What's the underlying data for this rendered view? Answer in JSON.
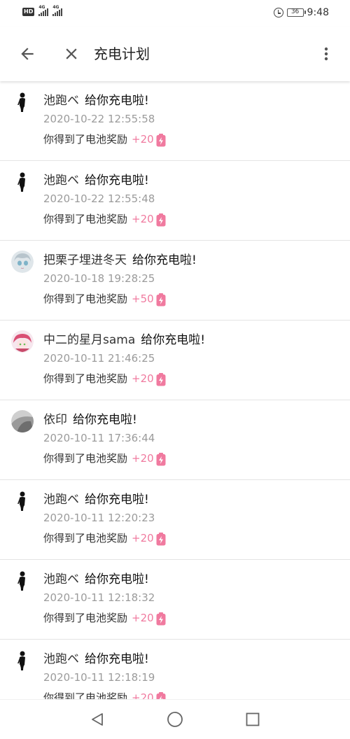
{
  "status_bar": {
    "hd": "HD",
    "net1": "4G",
    "net2": "4G",
    "battery": "36",
    "time": "9:48"
  },
  "header": {
    "title": "充电计划"
  },
  "list": [
    {
      "user": "池跑ベ",
      "action": "给你充电啦!",
      "time": "2020-10-22 12:55:58",
      "reward_text": "你得到了电池奖励",
      "reward": "+20",
      "avatar": "figure"
    },
    {
      "user": "池跑ベ",
      "action": "给你充电啦!",
      "time": "2020-10-22 12:55:48",
      "reward_text": "你得到了电池奖励",
      "reward": "+20",
      "avatar": "figure"
    },
    {
      "user": "把栗子埋进冬天",
      "action": "给你充电啦!",
      "time": "2020-10-18 19:28:25",
      "reward_text": "你得到了电池奖励",
      "reward": "+50",
      "avatar": "anime"
    },
    {
      "user": "中二的星月sama",
      "action": "给你充电啦!",
      "time": "2020-10-11 21:46:25",
      "reward_text": "你得到了电池奖励",
      "reward": "+20",
      "avatar": "pink"
    },
    {
      "user": "依印",
      "action": "给你充电啦!",
      "time": "2020-10-11 17:36:44",
      "reward_text": "你得到了电池奖励",
      "reward": "+20",
      "avatar": "gray"
    },
    {
      "user": "池跑ベ",
      "action": "给你充电啦!",
      "time": "2020-10-11 12:20:23",
      "reward_text": "你得到了电池奖励",
      "reward": "+20",
      "avatar": "figure"
    },
    {
      "user": "池跑ベ",
      "action": "给你充电啦!",
      "time": "2020-10-11 12:18:32",
      "reward_text": "你得到了电池奖励",
      "reward": "+20",
      "avatar": "figure"
    },
    {
      "user": "池跑ベ",
      "action": "给你充电啦!",
      "time": "2020-10-11 12:18:19",
      "reward_text": "你得到了电池奖励",
      "reward": "+20",
      "avatar": "figure"
    }
  ],
  "icons": {
    "back": "arrow-back-icon",
    "close": "close-icon",
    "more": "more-vertical-icon",
    "reward": "battery-icon"
  },
  "colors": {
    "accent_pink": "#f07a9f",
    "time_gray": "#9b9b9b",
    "divider": "#e4e4e4"
  }
}
